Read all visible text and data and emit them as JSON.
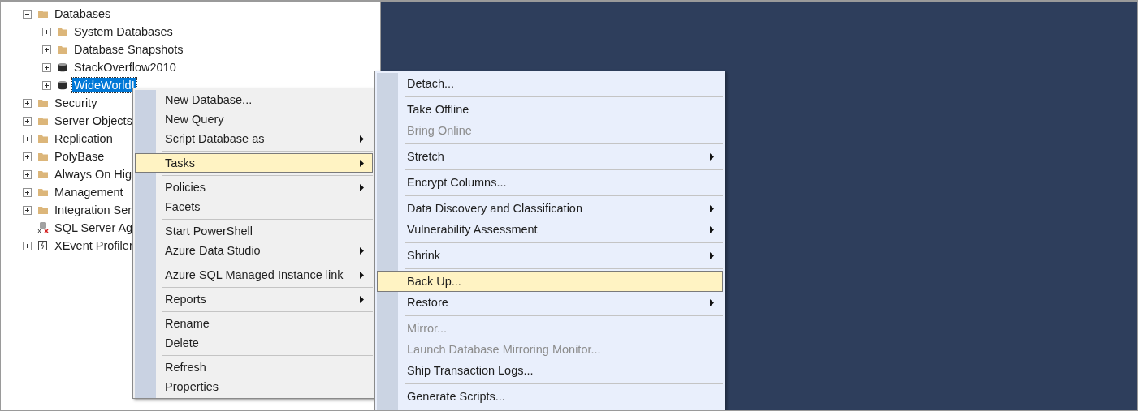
{
  "tree": [
    {
      "label": "Databases",
      "kind": "folder",
      "expanded": true,
      "selected": false,
      "children": [
        {
          "label": "System Databases",
          "kind": "folder",
          "expanded": false,
          "selected": false
        },
        {
          "label": "Database Snapshots",
          "kind": "folder",
          "expanded": false,
          "selected": false
        },
        {
          "label": "StackOverflow2010",
          "kind": "database",
          "expanded": false,
          "selected": false
        },
        {
          "label": "WideWorldI",
          "kind": "database",
          "expanded": false,
          "selected": true
        }
      ]
    },
    {
      "label": "Security",
      "kind": "folder",
      "expanded": false,
      "selected": false
    },
    {
      "label": "Server Objects",
      "kind": "folder",
      "expanded": false,
      "selected": false
    },
    {
      "label": "Replication",
      "kind": "folder",
      "expanded": false,
      "selected": false
    },
    {
      "label": "PolyBase",
      "kind": "folder",
      "expanded": false,
      "selected": false
    },
    {
      "label": "Always On Hig",
      "kind": "folder",
      "expanded": false,
      "selected": false
    },
    {
      "label": "Management",
      "kind": "folder",
      "expanded": false,
      "selected": false
    },
    {
      "label": "Integration Ser",
      "kind": "folder",
      "expanded": false,
      "selected": false
    },
    {
      "label": "SQL Server Ag",
      "kind": "agent",
      "selected": false
    },
    {
      "label": "XEvent Profiler",
      "kind": "profiler",
      "expanded": false,
      "selected": false
    }
  ],
  "context_menu": [
    {
      "kind": "item",
      "label": "New Database...",
      "submenu": false,
      "disabled": false,
      "selected": false
    },
    {
      "kind": "item",
      "label": "New Query",
      "submenu": false,
      "disabled": false,
      "selected": false
    },
    {
      "kind": "item",
      "label": "Script Database as",
      "submenu": true,
      "disabled": false,
      "selected": false
    },
    {
      "kind": "separator"
    },
    {
      "kind": "item",
      "label": "Tasks",
      "submenu": true,
      "disabled": false,
      "selected": true
    },
    {
      "kind": "separator"
    },
    {
      "kind": "item",
      "label": "Policies",
      "submenu": true,
      "disabled": false,
      "selected": false
    },
    {
      "kind": "item",
      "label": "Facets",
      "submenu": false,
      "disabled": false,
      "selected": false
    },
    {
      "kind": "separator"
    },
    {
      "kind": "item",
      "label": "Start PowerShell",
      "submenu": false,
      "disabled": false,
      "selected": false
    },
    {
      "kind": "item",
      "label": "Azure Data Studio",
      "submenu": true,
      "disabled": false,
      "selected": false
    },
    {
      "kind": "separator"
    },
    {
      "kind": "item",
      "label": "Azure SQL Managed Instance link",
      "submenu": true,
      "disabled": false,
      "selected": false
    },
    {
      "kind": "separator"
    },
    {
      "kind": "item",
      "label": "Reports",
      "submenu": true,
      "disabled": false,
      "selected": false
    },
    {
      "kind": "separator"
    },
    {
      "kind": "item",
      "label": "Rename",
      "submenu": false,
      "disabled": false,
      "selected": false
    },
    {
      "kind": "item",
      "label": "Delete",
      "submenu": false,
      "disabled": false,
      "selected": false
    },
    {
      "kind": "separator"
    },
    {
      "kind": "item",
      "label": "Refresh",
      "submenu": false,
      "disabled": false,
      "selected": false
    },
    {
      "kind": "item",
      "label": "Properties",
      "submenu": false,
      "disabled": false,
      "selected": false
    }
  ],
  "tasks_submenu": [
    {
      "kind": "item",
      "label": "Detach...",
      "submenu": false,
      "disabled": false,
      "selected": false
    },
    {
      "kind": "separator"
    },
    {
      "kind": "item",
      "label": "Take Offline",
      "submenu": false,
      "disabled": false,
      "selected": false
    },
    {
      "kind": "item",
      "label": "Bring Online",
      "submenu": false,
      "disabled": true,
      "selected": false
    },
    {
      "kind": "separator"
    },
    {
      "kind": "item",
      "label": "Stretch",
      "submenu": true,
      "disabled": false,
      "selected": false
    },
    {
      "kind": "separator"
    },
    {
      "kind": "item",
      "label": "Encrypt Columns...",
      "submenu": false,
      "disabled": false,
      "selected": false
    },
    {
      "kind": "separator"
    },
    {
      "kind": "item",
      "label": "Data Discovery and Classification",
      "submenu": true,
      "disabled": false,
      "selected": false
    },
    {
      "kind": "item",
      "label": "Vulnerability Assessment",
      "submenu": true,
      "disabled": false,
      "selected": false
    },
    {
      "kind": "separator"
    },
    {
      "kind": "item",
      "label": "Shrink",
      "submenu": true,
      "disabled": false,
      "selected": false
    },
    {
      "kind": "separator"
    },
    {
      "kind": "item",
      "label": "Back Up...",
      "submenu": false,
      "disabled": false,
      "selected": true
    },
    {
      "kind": "item",
      "label": "Restore",
      "submenu": true,
      "disabled": false,
      "selected": false
    },
    {
      "kind": "separator"
    },
    {
      "kind": "item",
      "label": "Mirror...",
      "submenu": false,
      "disabled": true,
      "selected": false
    },
    {
      "kind": "item",
      "label": "Launch Database Mirroring Monitor...",
      "submenu": false,
      "disabled": true,
      "selected": false
    },
    {
      "kind": "item",
      "label": "Ship Transaction Logs...",
      "submenu": false,
      "disabled": false,
      "selected": false
    },
    {
      "kind": "separator"
    },
    {
      "kind": "item",
      "label": "Generate Scripts...",
      "submenu": false,
      "disabled": false,
      "selected": false
    }
  ]
}
